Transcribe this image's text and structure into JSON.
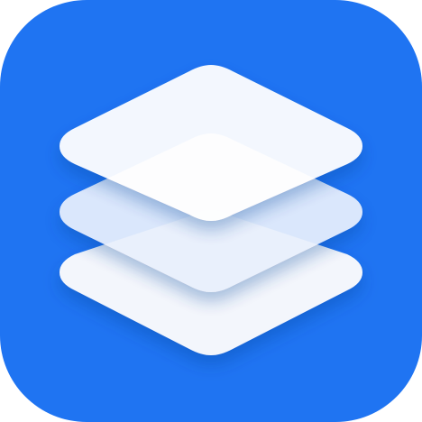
{
  "icon": {
    "name": "stacked-layers-app-icon",
    "glyph": "layers-icon",
    "background_color": "#1F74F2",
    "layer_color": "#FFFFFF",
    "layer_colors": [
      "#F3F6FC",
      "#E9F0FD"
    ],
    "layer_count": 3
  }
}
